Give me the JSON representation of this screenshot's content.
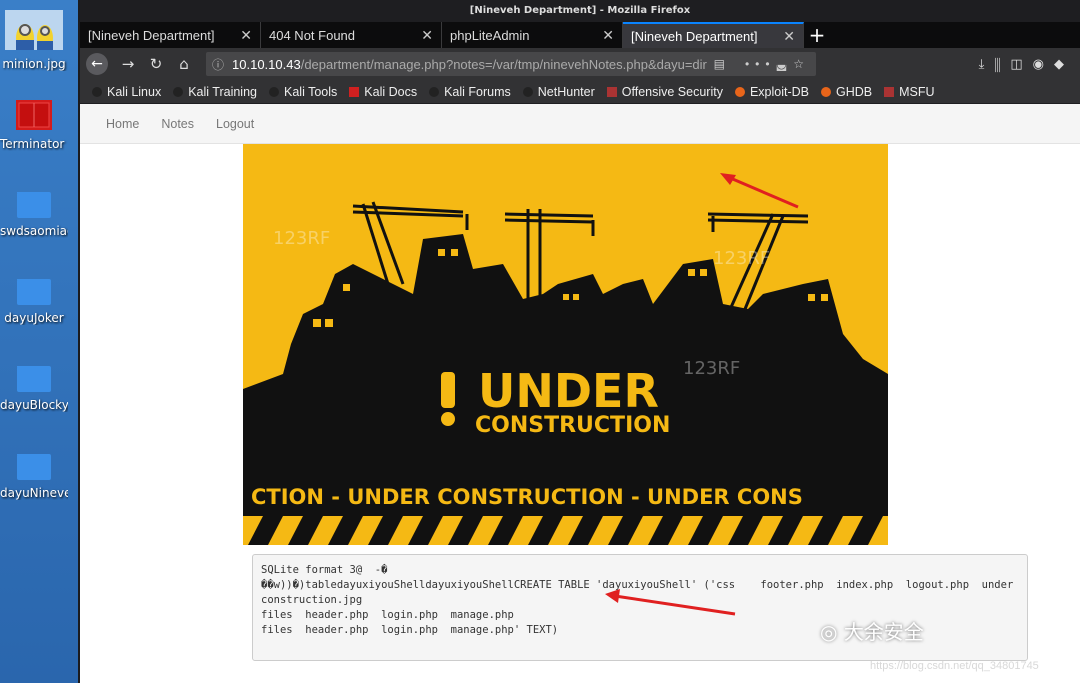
{
  "desktop": {
    "icons": [
      {
        "label": "minion.jpg",
        "icon": "image-icon"
      },
      {
        "label": "Terminator ...",
        "icon": "terminal-icon"
      },
      {
        "label": "swdsaomiao",
        "icon": "folder-icon"
      },
      {
        "label": "dayuJoker",
        "icon": "folder-icon"
      },
      {
        "label": "dayuBlocky",
        "icon": "folder-icon"
      },
      {
        "label": "dayuNineveh",
        "icon": "folder-icon"
      }
    ]
  },
  "window": {
    "title": "[Nineveh Department] - Mozilla Firefox"
  },
  "tabs": [
    {
      "label": "[Nineveh Department]"
    },
    {
      "label": "404 Not Found"
    },
    {
      "label": "phpLiteAdmin"
    },
    {
      "label": "[Nineveh Department]"
    }
  ],
  "url": {
    "host": "10.10.10.43",
    "path": "/department/manage.php?notes=/var/tmp/ninevehNotes.php&dayu=dir",
    "more": "•••"
  },
  "bookmarks": [
    {
      "label": "Kali Linux",
      "color": "#222222"
    },
    {
      "label": "Kali Training",
      "color": "#222222"
    },
    {
      "label": "Kali Tools",
      "color": "#222222"
    },
    {
      "label": "Kali Docs",
      "color": "#d02020"
    },
    {
      "label": "Kali Forums",
      "color": "#222222"
    },
    {
      "label": "NetHunter",
      "color": "#222222"
    },
    {
      "label": "Offensive Security",
      "color": "#aa3333"
    },
    {
      "label": "Exploit-DB",
      "color": "#e8651a"
    },
    {
      "label": "GHDB",
      "color": "#e8651a"
    },
    {
      "label": "MSFU",
      "color": "#aa3333"
    }
  ],
  "site_nav": [
    {
      "label": "Home"
    },
    {
      "label": "Notes"
    },
    {
      "label": "Logout"
    }
  ],
  "banner": {
    "headline": "UNDER",
    "subline": "CONSTRUCTION",
    "ticker": "CTION - UNDER  CONSTRUCTION - UNDER  CONS",
    "stock_watermark": "123RF",
    "colors": {
      "background": "#f5b914",
      "silhouette": "#111111"
    }
  },
  "notes_output": "SQLite format 3@  -�\n��w))�)tabledayuxiyouShelldayuxiyouShellCREATE TABLE 'dayuxiyouShell' ('css    footer.php  index.php  logout.php  underconstruction.jpg\nfiles  header.php  login.php  manage.php\nfiles  header.php  login.php  manage.php' TEXT)",
  "watermark": "大余安全",
  "csdn": "https://blog.csdn.net/qq_34801745"
}
